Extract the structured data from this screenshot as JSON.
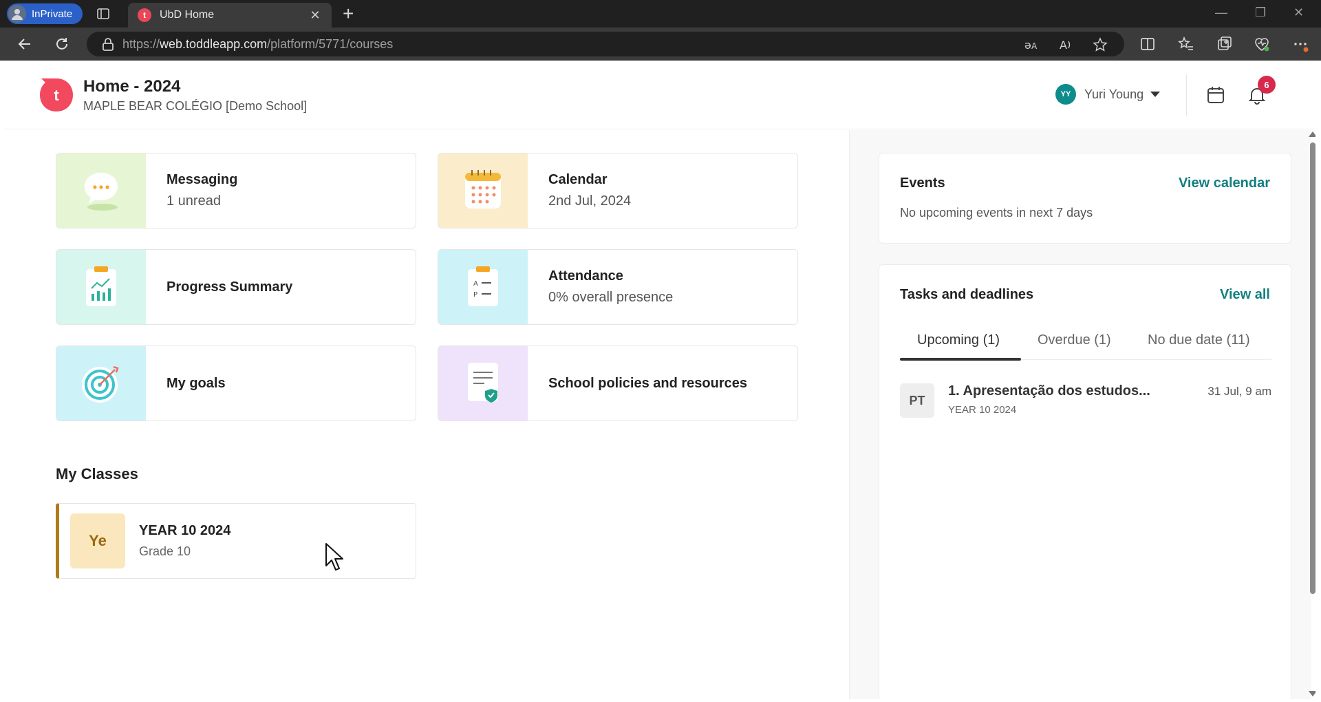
{
  "browser": {
    "inprivate_label": "InPrivate",
    "tab_title": "UbD Home",
    "tab_favicon_letter": "t",
    "url_scheme": "https://",
    "url_host": "web.toddleapp.com",
    "url_path": "/platform/5771/courses",
    "colors": {
      "chrome_dark": "#202020",
      "chrome_mid": "#3b3b3b",
      "inprivate_blue": "#2b60c9"
    }
  },
  "header": {
    "logo_letter": "t",
    "title": "Home - 2024",
    "school": "MAPLE BEAR COLÉGIO [Demo School]",
    "user_initials": "YY",
    "user_name": "Yuri Young",
    "notification_count": "6",
    "colors": {
      "logo": "#f2495f",
      "avatar": "#0e8c8c",
      "badge": "#d6294c"
    }
  },
  "cards": [
    {
      "id": "messaging",
      "title": "Messaging",
      "subtitle": "1 unread",
      "icon": "chat-bubble-icon",
      "color": "#e6f6d4"
    },
    {
      "id": "calendar",
      "title": "Calendar",
      "subtitle": "2nd Jul, 2024",
      "icon": "calendar-icon",
      "color": "#fbeccb"
    },
    {
      "id": "progress",
      "title": "Progress Summary",
      "subtitle": "",
      "icon": "progress-chart-icon",
      "color": "#d7f6ee"
    },
    {
      "id": "attendance",
      "title": "Attendance",
      "subtitle": "0% overall presence",
      "icon": "attendance-clipboard-icon",
      "color": "#cdf3f8"
    },
    {
      "id": "goals",
      "title": "My goals",
      "subtitle": "",
      "icon": "target-icon",
      "color": "#cdf3f8"
    },
    {
      "id": "policies",
      "title": "School policies and resources",
      "subtitle": "",
      "icon": "policy-document-icon",
      "color": "#efe2fb"
    }
  ],
  "my_classes": {
    "title": "My Classes",
    "classes": [
      {
        "abbr": "Ye",
        "name": "YEAR 10 2024",
        "grade": "Grade 10",
        "accent": "#b07a1b"
      }
    ]
  },
  "events": {
    "title": "Events",
    "link": "View calendar",
    "empty": "No upcoming events in next 7 days"
  },
  "tasks": {
    "title": "Tasks and deadlines",
    "link": "View all",
    "tabs": [
      "Upcoming (1)",
      "Overdue (1)",
      "No due date (11)"
    ],
    "active_tab": 0,
    "items": [
      {
        "abbr": "PT",
        "name": "1. Apresentação dos estudos...",
        "class": "YEAR 10 2024",
        "due": "31 Jul, 9 am"
      }
    ],
    "link_color": "#127f80"
  }
}
